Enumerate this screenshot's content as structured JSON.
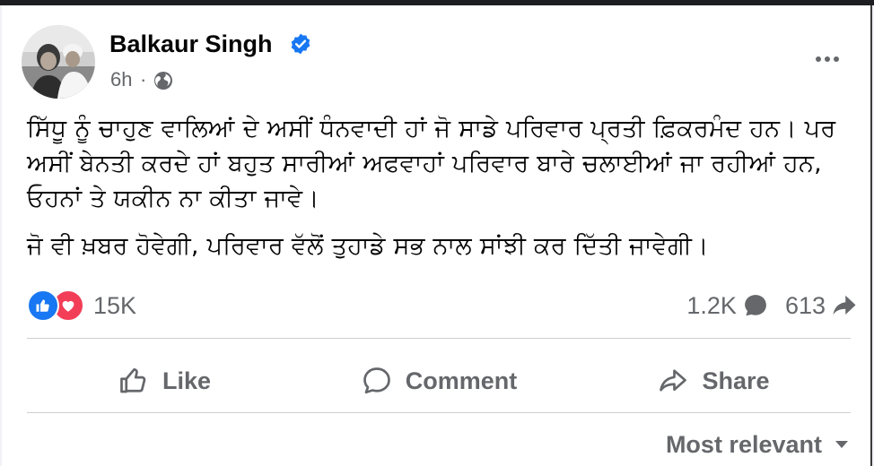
{
  "post": {
    "author": "Balkaur Singh",
    "verified": true,
    "time": "6h",
    "dot": "·",
    "audience_icon": "globe-icon",
    "paragraphs": [
      "ਸਿੱਧੂ ਨੂੰ ਚਾਹੁਣ ਵਾਲਿਆਂ ਦੇ ਅਸੀਂ ਧੰਨਵਾਦੀ ਹਾਂ ਜੋ ਸਾਡੇ ਪਰਿਵਾਰ ਪ੍ਰਤੀ ਫ਼ਿਕਰਮੰਦ ਹਨ। ਪਰ ਅਸੀਂ ਬੇਨਤੀ ਕਰਦੇ ਹਾਂ ਬਹੁਤ ਸਾਰੀਆਂ ਅਫਵਾਹਾਂ ਪਰਿਵਾਰ ਬਾਰੇ ਚਲਾਈਆਂ ਜਾ ਰਹੀਆਂ ਹਨ, ਓਹਨਾਂ ਤੇ ਯਕੀਨ ਨਾ ਕੀਤਾ ਜਾਵੇ।",
      "ਜੋ ਵੀ ਖ਼ਬਰ ਹੋਵੇਗੀ, ਪਰਿਵਾਰ ਵੱਲੋਂ ਤੁਹਾਡੇ ਸਭ ਨਾਲ ਸਾਂਝੀ ਕਰ ਦਿੱਤੀ ਜਾਵੇਗੀ।"
    ]
  },
  "reactions": {
    "types": [
      "like",
      "love"
    ],
    "count": "15K"
  },
  "stats": {
    "comments": "1.2K",
    "shares": "613"
  },
  "actions": {
    "like": "Like",
    "comment": "Comment",
    "share": "Share"
  },
  "sort": {
    "label": "Most relevant"
  },
  "colors": {
    "accent": "#1877f2",
    "love": "#f33e58",
    "muted": "#65676b",
    "text": "#050505"
  }
}
